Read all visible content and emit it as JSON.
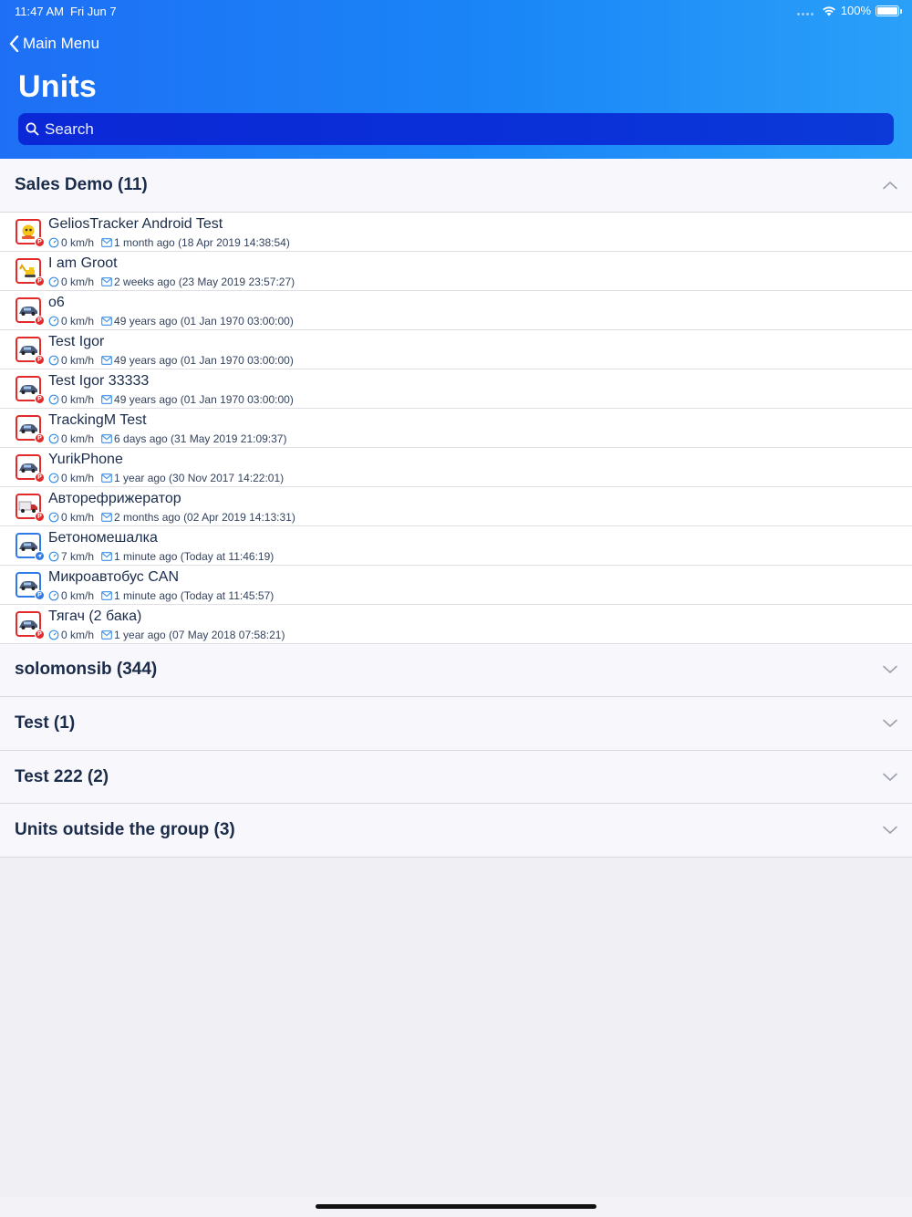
{
  "status_bar": {
    "time": "11:47 AM",
    "date": "Fri Jun 7",
    "battery": "100%"
  },
  "nav": {
    "back_label": "Main Menu"
  },
  "header": {
    "title": "Units"
  },
  "search": {
    "placeholder": "Search"
  },
  "colors": {
    "header_blue": "#1a86f7",
    "search_blue": "#0a30d8",
    "parked_red": "#e22a2a",
    "moving_blue": "#2f7ae6"
  },
  "groups": [
    {
      "title": "Sales Demo (11)",
      "expanded": true,
      "units": [
        {
          "name": "GeliosTracker Android Test",
          "speed": "0 km/h",
          "last_message": "1 month ago (18 Apr 2019 14:38:54)",
          "icon": "cartoon-icon",
          "status": "P"
        },
        {
          "name": "I am Groot",
          "speed": "0 km/h",
          "last_message": "2 weeks ago (23 May 2019 23:57:27)",
          "icon": "excavator-icon",
          "status": "P"
        },
        {
          "name": "o6",
          "speed": "0 km/h",
          "last_message": "49 years ago (01 Jan 1970 03:00:00)",
          "icon": "car-icon",
          "status": "P"
        },
        {
          "name": "Test Igor",
          "speed": "0 km/h",
          "last_message": "49 years ago (01 Jan 1970 03:00:00)",
          "icon": "car-icon",
          "status": "P"
        },
        {
          "name": "Test Igor 33333",
          "speed": "0 km/h",
          "last_message": "49 years ago (01 Jan 1970 03:00:00)",
          "icon": "car-icon",
          "status": "P"
        },
        {
          "name": "TrackingM Test",
          "speed": "0 km/h",
          "last_message": "6 days ago (31 May 2019 21:09:37)",
          "icon": "car-icon",
          "status": "P"
        },
        {
          "name": "YurikPhone",
          "speed": "0 km/h",
          "last_message": "1 year ago (30 Nov 2017 14:22:01)",
          "icon": "car-icon",
          "status": "P"
        },
        {
          "name": "Авторефрижератор",
          "speed": "0 km/h",
          "last_message": "2 months ago (02 Apr 2019 14:13:31)",
          "icon": "truck-icon",
          "status": "P"
        },
        {
          "name": "Бетономешалка",
          "speed": "7 km/h",
          "last_message": "1 minute ago (Today at 11:46:19)",
          "icon": "car-icon",
          "status": "moving"
        },
        {
          "name": "Микроавтобус  CAN",
          "speed": "0 km/h",
          "last_message": "1 minute ago (Today at 11:45:57)",
          "icon": "car-icon",
          "status": "P-blue"
        },
        {
          "name": "Тягач (2 бака)",
          "speed": "0 km/h",
          "last_message": "1 year ago (07 May 2018 07:58:21)",
          "icon": "car-icon",
          "status": "P"
        }
      ]
    },
    {
      "title": "solomonsib (344)",
      "expanded": false,
      "units": []
    },
    {
      "title": "Test (1)",
      "expanded": false,
      "units": []
    },
    {
      "title": "Test  222 (2)",
      "expanded": false,
      "units": []
    },
    {
      "title": "Units outside the group (3)",
      "expanded": false,
      "units": []
    }
  ]
}
